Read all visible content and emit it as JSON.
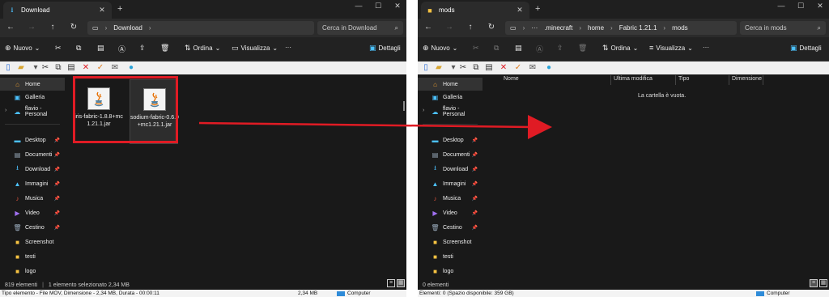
{
  "left": {
    "tab_title": "Download",
    "path": [
      "Download"
    ],
    "search_placeholder": "Cerca in Download",
    "cmd": {
      "new": "Nuovo",
      "sort": "Ordina",
      "view": "Visualizza",
      "more": "···",
      "details": "Dettagli"
    },
    "sidebar": {
      "home": "Home",
      "gallery": "Galleria",
      "cloud": "flavio - Personal",
      "items": [
        "Desktop",
        "Documenti",
        "Download",
        "Immagini",
        "Musica",
        "Video",
        "Cestino",
        "Screenshot",
        "testi",
        "logo"
      ]
    },
    "files": [
      {
        "name": "iris-fabric-1.8.8+mc1.21.1.jar"
      },
      {
        "name": "sodium-fabric-0.6.9+mc1.21.1.jar"
      }
    ],
    "status": {
      "count": "819 elementi",
      "selected": "1 elemento selezionato  2,34 MB"
    },
    "info": {
      "type": "Tipo elemento - File MOV, Dimensione - 2,34 MB, Durata - 00:00:11",
      "size": "2,34 MB",
      "computer": "Computer"
    }
  },
  "right": {
    "tab_title": "mods",
    "path": [
      "···",
      ".minecraft",
      "home",
      "Fabric 1.21.1",
      "mods"
    ],
    "search_placeholder": "Cerca in mods",
    "cmd": {
      "new": "Nuovo",
      "sort": "Ordina",
      "view": "Visualizza",
      "more": "···",
      "details": "Dettagli"
    },
    "sidebar": {
      "home": "Home",
      "gallery": "Galleria",
      "cloud": "flavio - Personal",
      "items": [
        "Desktop",
        "Documenti",
        "Download",
        "Immagini",
        "Musica",
        "Video",
        "Cestino",
        "Screenshot",
        "testi",
        "logo"
      ]
    },
    "columns": [
      "Nome",
      "Ultima modifica",
      "Tipo",
      "Dimensione"
    ],
    "empty_text": "La cartella è vuota.",
    "status": {
      "count": "0 elementi"
    },
    "info": {
      "type": "Elementi: 0 (Spazio disponibile: 359 GB)",
      "computer": "Computer"
    }
  },
  "colors": {
    "highlight": "#e01b24",
    "arrow": "#e01b24",
    "folder": "#f5c242",
    "accent": "#2e8bd8"
  }
}
